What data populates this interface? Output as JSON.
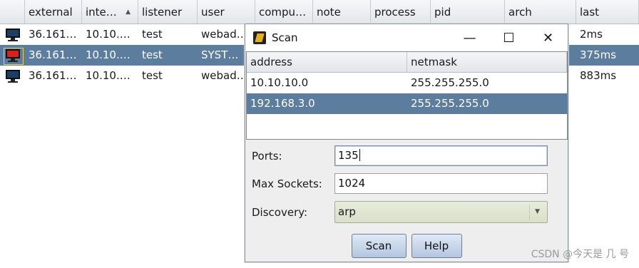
{
  "sessions": {
    "columns": [
      "external",
      "inte…",
      "listener",
      "user",
      "compu…",
      "note",
      "process",
      "pid",
      "arch",
      "last"
    ],
    "rows": [
      {
        "external": "36.161…",
        "internal": "10.10.…",
        "listener": "test",
        "user": "webad…",
        "last": "2ms",
        "icon": "computer-icon"
      },
      {
        "external": "36.161…",
        "internal": "10.10.…",
        "listener": "test",
        "user": "SYST…",
        "last": "375ms",
        "icon": "computer-alert-icon"
      },
      {
        "external": "36.161…",
        "internal": "10.10.…",
        "listener": "test",
        "user": "webad…",
        "last": "883ms",
        "icon": "computer-icon"
      }
    ]
  },
  "dialog": {
    "title": "Scan",
    "window_buttons": {
      "minimize": "—",
      "maximize": "☐",
      "close": "✕"
    },
    "list": {
      "columns": [
        "address",
        "netmask"
      ],
      "rows": [
        {
          "address": "10.10.10.0",
          "netmask": "255.255.255.0"
        },
        {
          "address": "192.168.3.0",
          "netmask": "255.255.255.0"
        }
      ]
    },
    "ports": {
      "label": "Ports:",
      "value": "135"
    },
    "max_sockets": {
      "label": "Max Sockets:",
      "value": "1024"
    },
    "discovery": {
      "label": "Discovery:",
      "value": "arp"
    },
    "scan_button": "Scan",
    "help_button": "Help"
  },
  "watermark": "CSDN @今天是 几 号",
  "colors": {
    "selection": "#5c7d9e",
    "button": "#c9d8ec",
    "select": "#dde3cf"
  }
}
